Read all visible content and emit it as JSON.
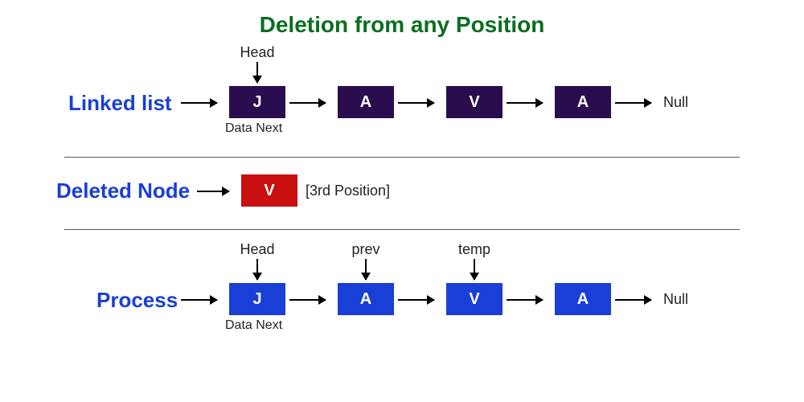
{
  "title": "Deletion from any Position",
  "section1": {
    "label": "Linked list",
    "headLabel": "Head",
    "dataNextLabel": "Data Next",
    "nullLabel": "Null",
    "nodes": [
      "J",
      "A",
      "V",
      "A"
    ]
  },
  "section2": {
    "label": "Deleted Node",
    "nodeValue": "V",
    "positionLabel": "[3rd Position]"
  },
  "section3": {
    "label": "Process",
    "headLabel": "Head",
    "prevLabel": "prev",
    "tempLabel": "temp",
    "dataNextLabel": "Data Next",
    "nullLabel": "Null",
    "nodes": [
      "J",
      "A",
      "V",
      "A"
    ]
  }
}
